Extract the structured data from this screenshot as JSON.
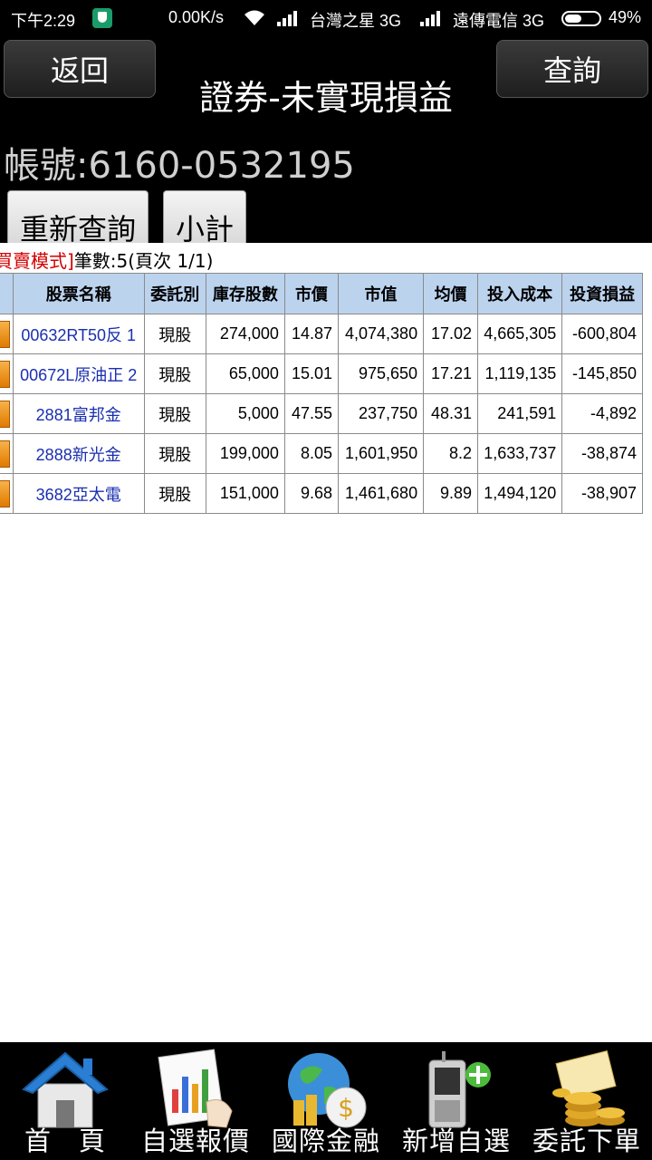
{
  "status": {
    "time": "下午2:29",
    "speed": "0.00K/s",
    "carrier1": "台灣之星 3G",
    "carrier2": "遠傳電信 3G",
    "battery": "49%"
  },
  "header": {
    "back_label": "返回",
    "title": "證券-未實現損益",
    "query_label": "查詢",
    "account": "帳號:6160-0532195",
    "requery_label": "重新查詢",
    "subtotal_label": "小計"
  },
  "info": {
    "mode": "買賣模式]",
    "summary": "筆數:5(頁次 1/1)"
  },
  "table": {
    "headers": [
      "股票名稱",
      "委託別",
      "庫存股數",
      "市價",
      "市值",
      "均價",
      "投入成本",
      "投資損益"
    ],
    "rows": [
      {
        "name": "00632RT50反 1",
        "type": "現股",
        "shares": "274,000",
        "price": "14.87",
        "value": "4,074,380",
        "avg": "17.02",
        "cost": "4,665,305",
        "pl": "-600,804"
      },
      {
        "name": "00672L原油正 2",
        "type": "現股",
        "shares": "65,000",
        "price": "15.01",
        "value": "975,650",
        "avg": "17.21",
        "cost": "1,119,135",
        "pl": "-145,850"
      },
      {
        "name": "2881富邦金",
        "type": "現股",
        "shares": "5,000",
        "price": "47.55",
        "value": "237,750",
        "avg": "48.31",
        "cost": "241,591",
        "pl": "-4,892"
      },
      {
        "name": "2888新光金",
        "type": "現股",
        "shares": "199,000",
        "price": "8.05",
        "value": "1,601,950",
        "avg": "8.2",
        "cost": "1,633,737",
        "pl": "-38,874"
      },
      {
        "name": "3682亞太電",
        "type": "現股",
        "shares": "151,000",
        "price": "9.68",
        "value": "1,461,680",
        "avg": "9.89",
        "cost": "1,494,120",
        "pl": "-38,907"
      }
    ]
  },
  "nav": [
    {
      "label": "首　頁",
      "icon": "home-icon"
    },
    {
      "label": "自選報價",
      "icon": "chart-quote-icon"
    },
    {
      "label": "國際金融",
      "icon": "globe-money-icon"
    },
    {
      "label": "新增自選",
      "icon": "phone-add-icon"
    },
    {
      "label": "委託下單",
      "icon": "coins-order-icon"
    }
  ],
  "colors": {
    "header_bg": "#000000",
    "table_header_bg": "#bcd3ee",
    "stock_name": "#1a2fb0",
    "mode_text": "#d40000"
  }
}
